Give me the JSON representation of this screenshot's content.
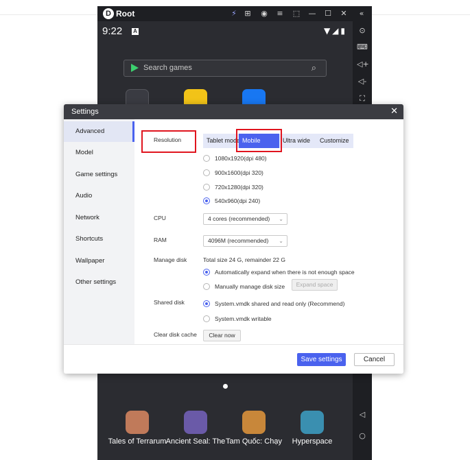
{
  "app": {
    "name": "Root",
    "logo_letter": "D",
    "titlebar_icons": [
      "bolt-icon",
      "gamepad-icon",
      "account-icon",
      "menu-icon",
      "screenshot-icon",
      "minimize-icon",
      "maximize-icon",
      "close-icon",
      "collapse-icon"
    ]
  },
  "status": {
    "time": "9:22",
    "badge": "A"
  },
  "search": {
    "placeholder": "Search games"
  },
  "games": [
    {
      "label": "Tales of Terrarum",
      "color": "#c07a5a"
    },
    {
      "label": "Ancient Seal: The",
      "color": "#6a5aa8"
    },
    {
      "label": "Tam Quốc: Chạy",
      "color": "#c8873a"
    },
    {
      "label": "Hyperspace",
      "color": "#3a8fb0"
    }
  ],
  "settings": {
    "title": "Settings",
    "nav": [
      "Advanced",
      "Model",
      "Game settings",
      "Audio",
      "Network",
      "Shortcuts",
      "Wallpaper",
      "Other settings"
    ],
    "active_nav": "Advanced",
    "resolution": {
      "label": "Resolution",
      "tabs": [
        "Tablet mode",
        "Mobile mode",
        "Ultra wide",
        "Customize"
      ],
      "active_tab": "Mobile mode",
      "options": [
        "1080x1920(dpi 480)",
        "900x1600(dpi 320)",
        "720x1280(dpi 320)",
        "540x960(dpi 240)"
      ],
      "selected": "540x960(dpi 240)"
    },
    "cpu": {
      "label": "CPU",
      "value": "4 cores (recommended)"
    },
    "ram": {
      "label": "RAM",
      "value": "4096M (recommended)"
    },
    "disk": {
      "label": "Manage disk",
      "summary": "Total size 24 G, remainder 22 G",
      "auto": "Automatically expand when there is not enough space",
      "manual": "Manually manage disk size",
      "expand_button": "Expand space"
    },
    "shared_disk": {
      "label": "Shared disk",
      "opt1": "System.vmdk shared and read only (Recommend)",
      "opt2": "System.vmdk writable"
    },
    "cache": {
      "label": "Clear disk cache",
      "button": "Clear now"
    },
    "save": "Save settings",
    "cancel": "Cancel"
  },
  "colors": {
    "accent": "#4a62ee",
    "highlight": "#e0141e",
    "dialog_header": "#3b3c42"
  }
}
